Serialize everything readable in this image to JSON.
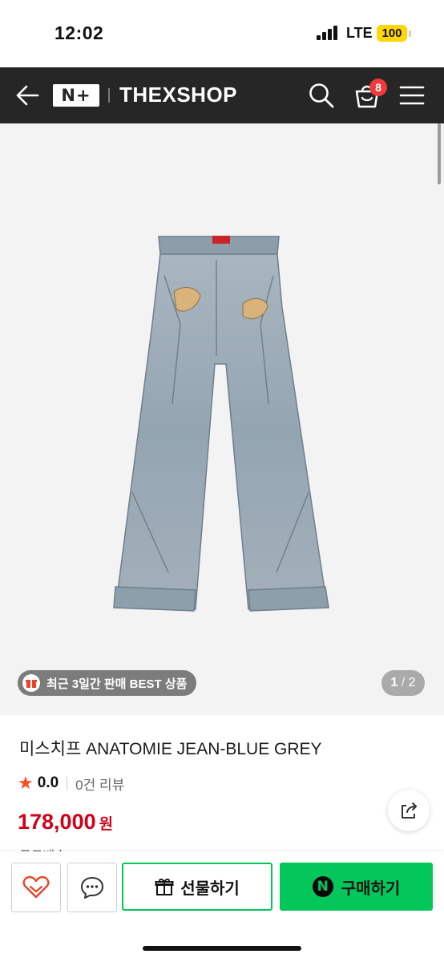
{
  "status_bar": {
    "time": "12:02",
    "network": "LTE",
    "battery": "100"
  },
  "nav": {
    "logo": "N+",
    "brand": "THEXSHOP",
    "cart_count": "8"
  },
  "gallery": {
    "badge": "최근 3일간 판매 BEST 상품",
    "page_current": "1",
    "page_total": "2"
  },
  "product": {
    "title": "미스치프 ANATOMIE JEAN-BLUE GREY",
    "rating": "0.0",
    "reviews": "0건 리뷰",
    "price": "178,000",
    "currency": "원",
    "cut_text": "무료배송"
  },
  "actions": {
    "gift_label": "선물하기",
    "buy_label": "구매하기",
    "buy_badge": "N"
  },
  "colors": {
    "accent": "#03c75a",
    "price": "#d0021b",
    "nav_bg": "#262626",
    "star": "#ff4d1f"
  }
}
